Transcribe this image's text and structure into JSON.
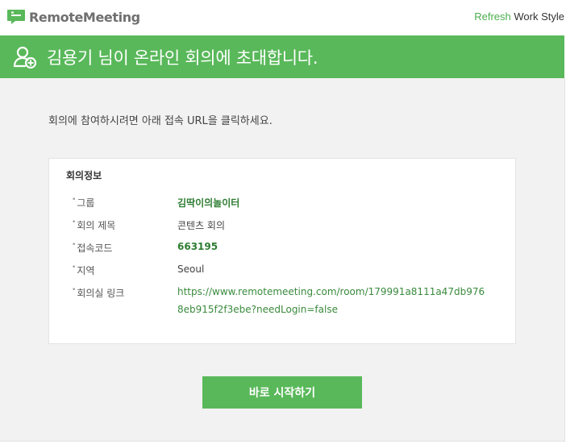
{
  "brand": {
    "logo_text": "RemoteMeeting",
    "tagline_accent": "Refresh",
    "tagline_rest": "Work Style",
    "color_accent": "#59b85a"
  },
  "banner": {
    "icon": "user-add-icon",
    "title": "김용기 님이 온라인 회의에 초대합니다."
  },
  "intro_text": "회의에 참여하시려면 아래 접속 URL을 클릭하세요.",
  "meeting_info": {
    "heading": "회의정보",
    "rows": [
      {
        "label": "그룹",
        "value": "김딱이의놀이터"
      },
      {
        "label": "회의 제목",
        "value": "콘텐츠 회의"
      },
      {
        "label": "접속코드",
        "value": "663195"
      },
      {
        "label": "지역",
        "value": "Seoul"
      },
      {
        "label": "회의실 링크",
        "value_line1": "https://www.remotemeeting.com/room/179991a8111a47db976",
        "value_line2": "8eb915f2f3ebe?needLogin=false"
      }
    ]
  },
  "start_button_label": "바로 시작하기"
}
